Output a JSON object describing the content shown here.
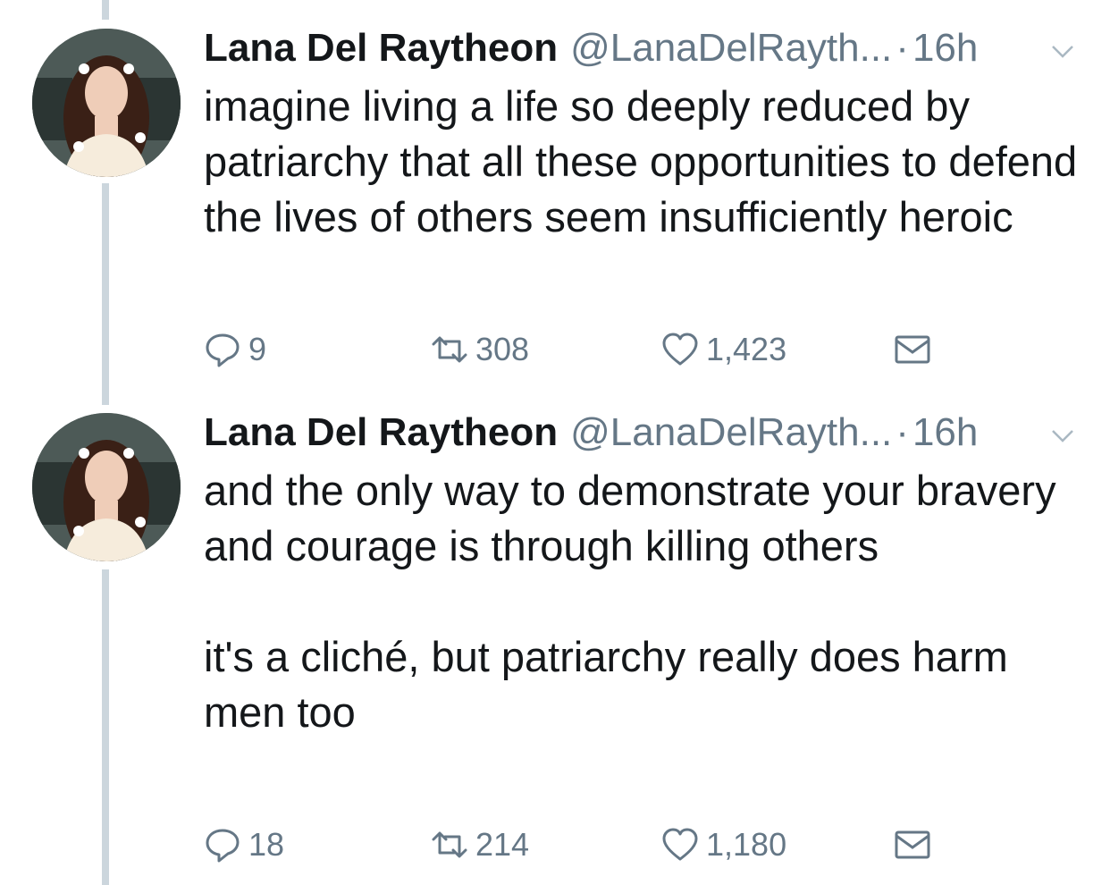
{
  "tweets": [
    {
      "name": "Lana Del Raytheon",
      "handle": "@LanaDelRayth...",
      "dot": "·",
      "time": "16h",
      "text": [
        "imagine living a life so deeply reduced by patriarchy that all these opportunities to defend the lives of others seem insufficiently heroic"
      ],
      "replies": "9",
      "retweets": "308",
      "likes": "1,423"
    },
    {
      "name": "Lana Del Raytheon",
      "handle": "@LanaDelRayth...",
      "dot": "·",
      "time": "16h",
      "text": [
        "and the only way to demonstrate your bravery and courage is through killing others",
        "it's a cliché, but patriarchy really does harm men too"
      ],
      "replies": "18",
      "retweets": "214",
      "likes": "1,180"
    }
  ],
  "icons": {
    "avatar": "profile-photo",
    "caret": "chevron-down-icon",
    "reply": "reply-icon",
    "retweet": "retweet-icon",
    "like": "heart-icon",
    "dm": "envelope-icon"
  },
  "colors": {
    "text": "#14171a",
    "secondary": "#657786",
    "thread_line": "#ccd6dd"
  }
}
